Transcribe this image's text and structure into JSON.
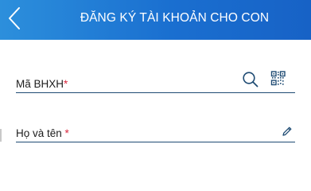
{
  "header": {
    "title": "ĐĂNG KÝ TÀI KHOẢN CHO CON",
    "back_icon": "chevron-left-icon",
    "background": "#1a6fd0"
  },
  "form": {
    "bhxh_field": {
      "label": "Mã BHXH",
      "required_mark": "*",
      "value": "",
      "search_icon": "search-icon",
      "qr_icon": "qr-code-icon"
    },
    "name_field": {
      "label": "Họ và tên ",
      "required_mark": "*",
      "value": "",
      "edit_icon": "pencil-icon"
    },
    "required_color": "#d9283e",
    "underline_color": "#1e4b73"
  }
}
